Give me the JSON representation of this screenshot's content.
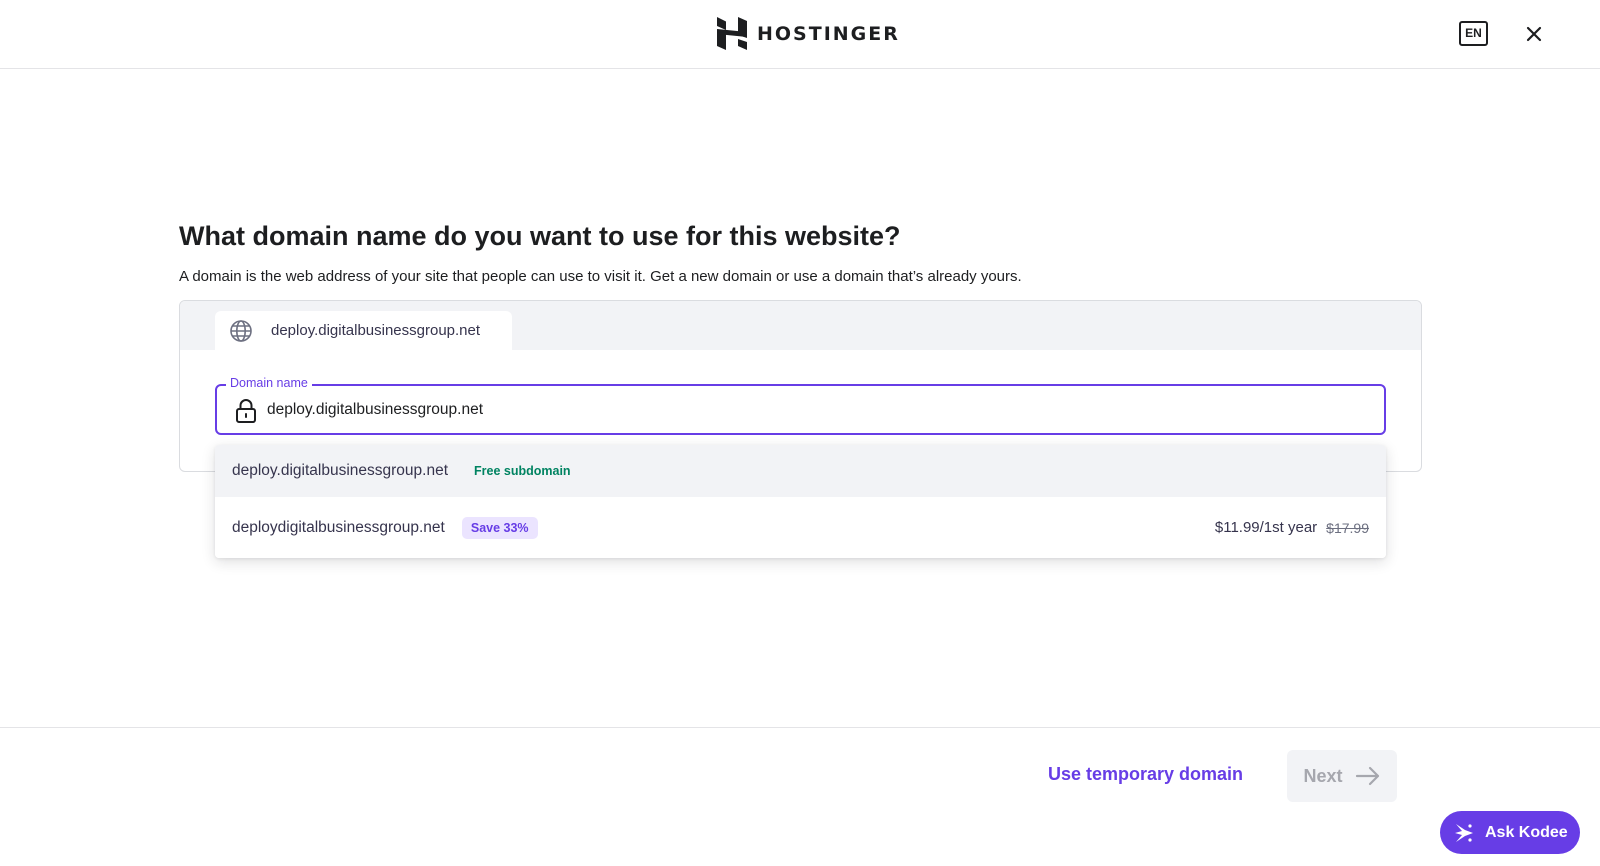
{
  "header": {
    "brand": "HOSTINGER",
    "language": "EN"
  },
  "main": {
    "title": "What domain name do you want to use for this website?",
    "subtitle": "A domain is the web address of your site that people can use to visit it. Get a new domain or use a domain that’s already yours.",
    "tab_label": "deploy.digitalbusinessgroup.net",
    "field_label": "Domain name",
    "field_value": "deploy.digitalbusinessgroup.net",
    "options": [
      {
        "name": "deploy.digitalbusinessgroup.net",
        "badge": "Free subdomain"
      },
      {
        "name": "deploydigitalbusinessgroup.net",
        "badge": "Save 33%",
        "price": "$11.99/1st year",
        "old_price": "$17.99"
      }
    ]
  },
  "footer": {
    "temp_domain_label": "Use temporary domain",
    "next_label": "Next",
    "kodee_label": "Ask Kodee"
  },
  "colors": {
    "accent": "#673de6",
    "success": "#008361"
  }
}
